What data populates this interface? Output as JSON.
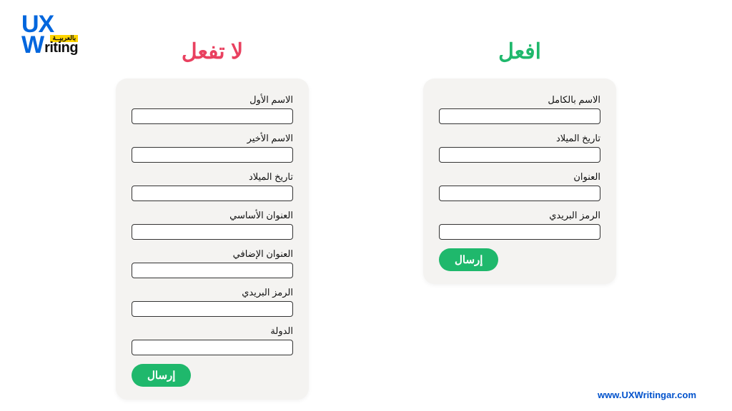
{
  "logo": {
    "line1": "UX",
    "w": "W",
    "riting": "riting",
    "arabic_tag": "بالعربيــة"
  },
  "dont": {
    "heading": "لا تفعل",
    "fields": [
      "الاسم الأول",
      "الاسم الأخير",
      "تاريخ الميلاد",
      "العنوان الأساسي",
      "العنوان الإضافي",
      "الرمز البريدي",
      "الدولة"
    ],
    "submit": "إرسال"
  },
  "do": {
    "heading": "افعل",
    "fields": [
      "الاسم بالكامل",
      "تاريخ الميلاد",
      "العنوان",
      "الرمز البريدي"
    ],
    "submit": "إرسال"
  },
  "footer": {
    "url": "www.UXWritingar.com"
  }
}
